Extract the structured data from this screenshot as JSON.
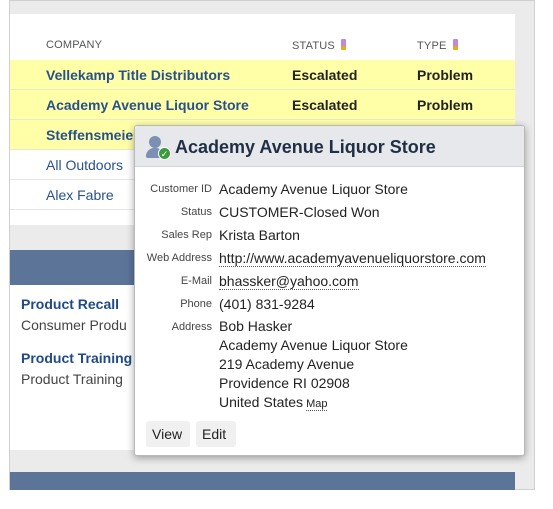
{
  "table": {
    "headers": {
      "company": "COMPANY",
      "status": "STATUS",
      "type": "TYPE"
    },
    "rows": [
      {
        "company": "Vellekamp Title Distributors",
        "status": "Escalated",
        "type": "Problem"
      },
      {
        "company": "Academy Avenue Liquor Store",
        "status": "Escalated",
        "type": "Problem"
      },
      {
        "company": "Steffensmeie",
        "status": "",
        "type": ""
      },
      {
        "company": "All Outdoors",
        "status": "",
        "type": ""
      },
      {
        "company": "Alex Fabre",
        "status": "",
        "type": ""
      }
    ]
  },
  "promos": [
    {
      "title": "Product Recall",
      "subtitle": "Consumer Produ"
    },
    {
      "title": "Product Training",
      "subtitle": "Product Training"
    }
  ],
  "popup": {
    "title": "Academy Avenue Liquor Store",
    "fields": {
      "customer_id": {
        "label": "Customer ID",
        "value": "Academy Avenue Liquor Store"
      },
      "status": {
        "label": "Status",
        "value": "CUSTOMER-Closed Won"
      },
      "sales_rep": {
        "label": "Sales Rep",
        "value": "Krista Barton"
      },
      "web_address": {
        "label": "Web Address",
        "value": "http://www.academyavenueliquorstore.com"
      },
      "email": {
        "label": "E-Mail",
        "value": "bhassker@yahoo.com"
      },
      "phone": {
        "label": "Phone",
        "value": "(401) 831-9284"
      },
      "address": {
        "label": "Address",
        "lines": [
          "Bob Hasker",
          "Academy Avenue Liquor Store",
          "219 Academy Avenue",
          "Providence RI 02908",
          "United States"
        ],
        "map_link": "Map"
      }
    },
    "buttons": {
      "view": "View",
      "edit": "Edit"
    }
  },
  "colors": {
    "highlight_row": "#ffffa8",
    "link_blue": "#28508c",
    "section_bar": "#5b7498"
  },
  "icons": {
    "popup_avatar": "customer-check-icon",
    "column_edit": "pencil-icon"
  }
}
